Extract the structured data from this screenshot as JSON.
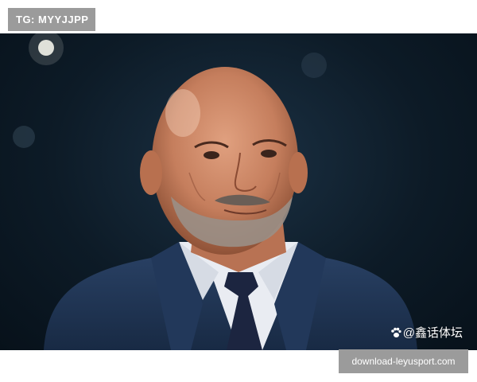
{
  "top_tag": {
    "text": "TG: MYYJJPP"
  },
  "photo": {
    "watermark_text": "@鑫话体坛",
    "watermark_icon": "paw-icon"
  },
  "download_tag": {
    "text": "download-leyusport.com"
  },
  "colors": {
    "tag_bg": "#9b9b9b",
    "page_bg": "#ffffff",
    "photo_bg": "#0d1b27"
  }
}
